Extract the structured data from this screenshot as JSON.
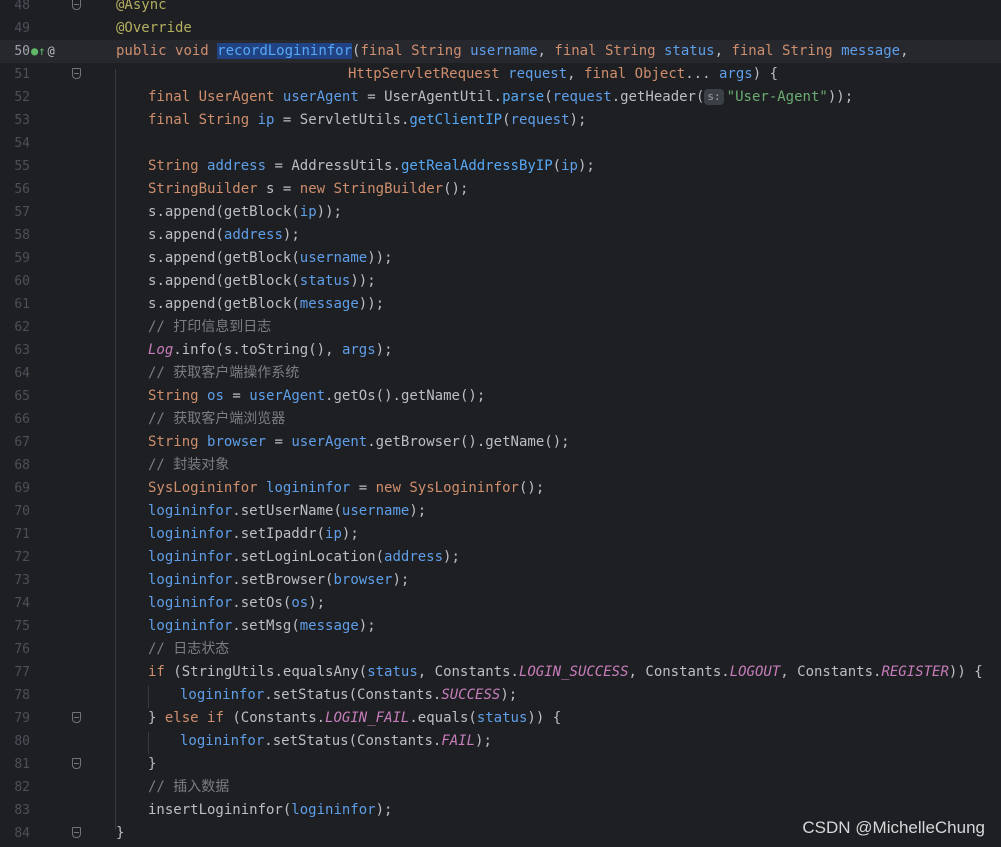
{
  "editor": {
    "language": "Java",
    "current_line": "50",
    "lines": [
      {
        "n": "48",
        "code": "@Async"
      },
      {
        "n": "49",
        "code": "@Override"
      },
      {
        "n": "50",
        "code": "public void recordLogininfor(final String username, final String status, final String message,"
      },
      {
        "n": "51",
        "code": "HttpServletRequest request, final Object... args) {"
      },
      {
        "n": "52",
        "code": "final UserAgent userAgent = UserAgentUtil.parse(request.getHeader(s:\"User-Agent\"));"
      },
      {
        "n": "53",
        "code": "final String ip = ServletUtils.getClientIP(request);"
      },
      {
        "n": "54",
        "code": ""
      },
      {
        "n": "55",
        "code": "String address = AddressUtils.getRealAddressByIP(ip);"
      },
      {
        "n": "56",
        "code": "StringBuilder s = new StringBuilder();"
      },
      {
        "n": "57",
        "code": "s.append(getBlock(ip));"
      },
      {
        "n": "58",
        "code": "s.append(address);"
      },
      {
        "n": "59",
        "code": "s.append(getBlock(username));"
      },
      {
        "n": "60",
        "code": "s.append(getBlock(status));"
      },
      {
        "n": "61",
        "code": "s.append(getBlock(message));"
      },
      {
        "n": "62",
        "code": "// 打印信息到日志"
      },
      {
        "n": "63",
        "code": "Log.info(s.toString(), args);"
      },
      {
        "n": "64",
        "code": "// 获取客户端操作系统"
      },
      {
        "n": "65",
        "code": "String os = userAgent.getOs().getName();"
      },
      {
        "n": "66",
        "code": "// 获取客户端浏览器"
      },
      {
        "n": "67",
        "code": "String browser = userAgent.getBrowser().getName();"
      },
      {
        "n": "68",
        "code": "// 封装对象"
      },
      {
        "n": "69",
        "code": "SysLogininfor logininfor = new SysLogininfor();"
      },
      {
        "n": "70",
        "code": "logininfor.setUserName(username);"
      },
      {
        "n": "71",
        "code": "logininfor.setIpaddr(ip);"
      },
      {
        "n": "72",
        "code": "logininfor.setLoginLocation(address);"
      },
      {
        "n": "73",
        "code": "logininfor.setBrowser(browser);"
      },
      {
        "n": "74",
        "code": "logininfor.setOs(os);"
      },
      {
        "n": "75",
        "code": "logininfor.setMsg(message);"
      },
      {
        "n": "76",
        "code": "// 日志状态"
      },
      {
        "n": "77",
        "code": "if (StringUtils.equalsAny(status, Constants.LOGIN_SUCCESS, Constants.LOGOUT, Constants.REGISTER)) {"
      },
      {
        "n": "78",
        "code": "logininfor.setStatus(Constants.SUCCESS);"
      },
      {
        "n": "79",
        "code": "} else if (Constants.LOGIN_FAIL.equals(status)) {"
      },
      {
        "n": "80",
        "code": "logininfor.setStatus(Constants.FAIL);"
      },
      {
        "n": "81",
        "code": "}"
      },
      {
        "n": "82",
        "code": "// 插入数据"
      },
      {
        "n": "83",
        "code": "insertLogininfor(logininfor);"
      },
      {
        "n": "84",
        "code": "}"
      }
    ]
  },
  "watermark": "CSDN @MichelleChung",
  "colors": {
    "background": "#1e1f22",
    "keyword": "#cf8e6d",
    "method": "#56a8f5",
    "annotation": "#b3ae60",
    "string": "#6aab73",
    "comment": "#7a7e85",
    "constant": "#c77dbb",
    "selection": "#214283"
  },
  "icons": [
    "implements-icon",
    "annotation-at-icon",
    "fold-marker-icon"
  ]
}
